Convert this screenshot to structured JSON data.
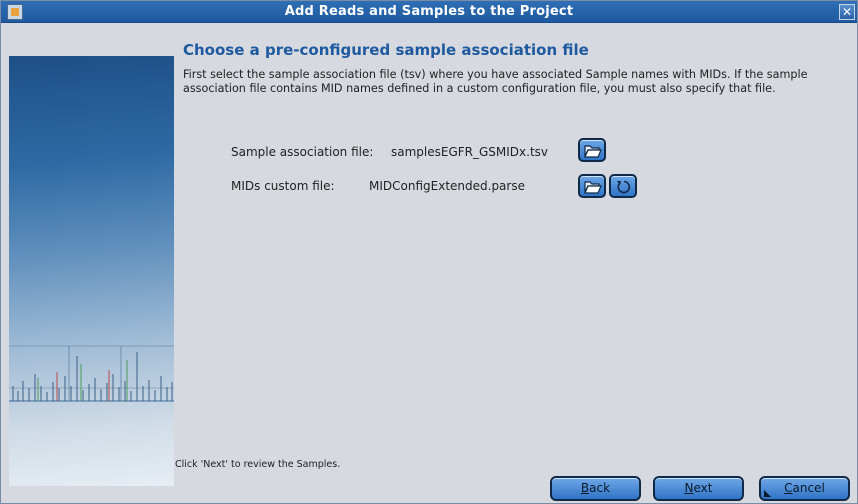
{
  "window": {
    "title": "Add Reads and Samples to the Project",
    "close_glyph": "✕"
  },
  "page": {
    "heading": "Choose a pre-configured sample association file",
    "description": "First select the sample association file (tsv) where you have associated Sample names with MIDs. If the sample association file contains MID names defined in a custom configuration file, you must also specify that file.",
    "footer_note": "Click 'Next' to review the Samples."
  },
  "fields": {
    "sample_label": "Sample association file:",
    "sample_value": "samplesEGFR_GSMIDx.tsv",
    "mids_label": "MIDs custom file:",
    "mids_value": "MIDConfigExtended.parse"
  },
  "buttons": {
    "back_mnemonic": "B",
    "back_rest": "ack",
    "next_mnemonic": "N",
    "next_rest": "ext",
    "cancel_mnemonic": "C",
    "cancel_rest": "ancel"
  },
  "icons": {
    "browse_sample": "folder-open-icon",
    "browse_mids": "folder-open-icon",
    "reset_mids": "reset-icon",
    "app": "java-app-icon"
  },
  "colors": {
    "title_bar": "#1f5aa0",
    "heading": "#1f5aa0",
    "button": "#3a7fcf",
    "background": "#d6d9df"
  }
}
